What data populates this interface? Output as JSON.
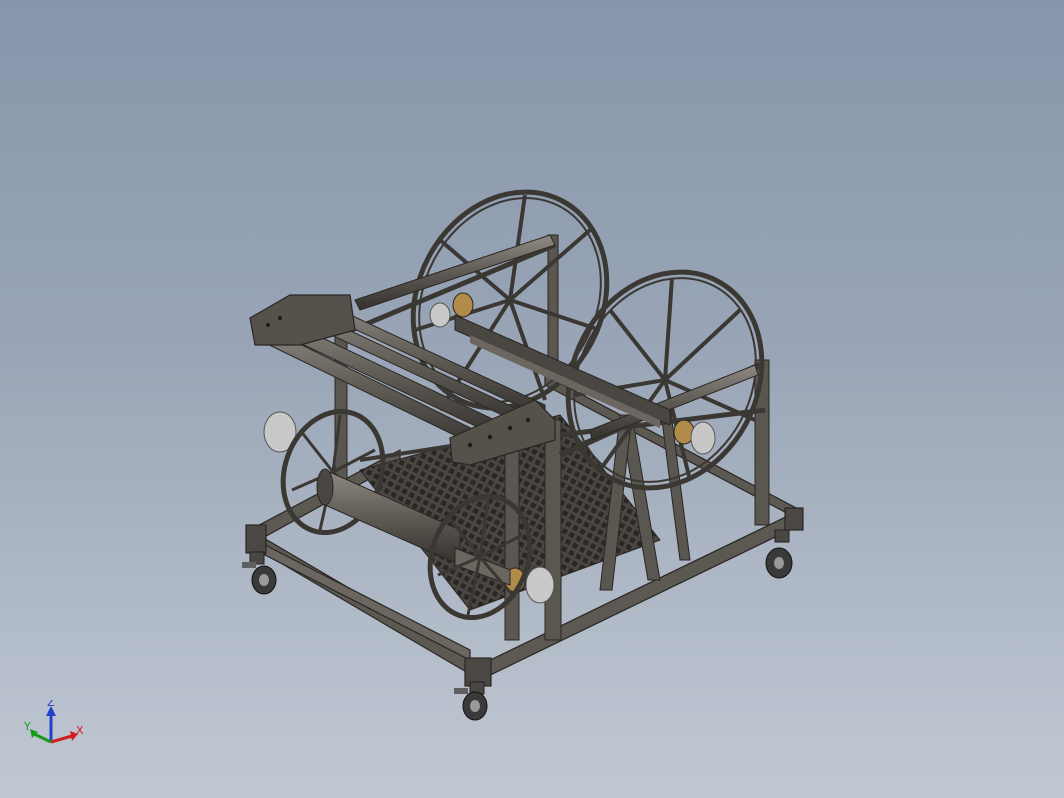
{
  "viewport": {
    "model_name": "cable-reel-cart-3d-model",
    "colors": {
      "background_top": "#8796ab",
      "background_bottom": "#c0c8d3",
      "steel": "#5a5650",
      "steel_dark": "#2f2c29",
      "steel_light": "#8a847b",
      "bearing": "#b08b4a"
    }
  },
  "triad": {
    "x_label": "X",
    "y_label": "Y",
    "z_label": "Z",
    "x_color": "#d02020",
    "y_color": "#1a9a1a",
    "z_color": "#2040d0"
  }
}
